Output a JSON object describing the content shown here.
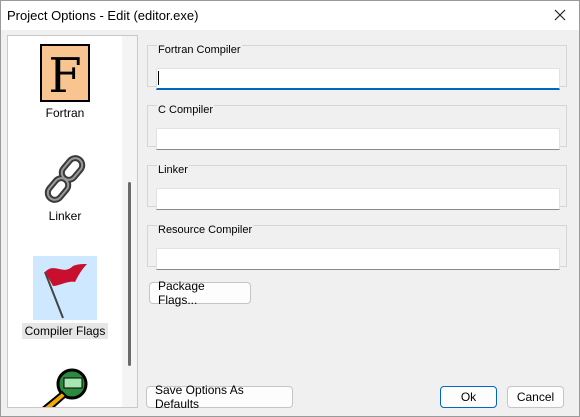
{
  "window": {
    "title": "Project Options - Edit (editor.exe)"
  },
  "sidebar": {
    "items": [
      {
        "label": "Fortran",
        "icon": "fortran-icon"
      },
      {
        "label": "Linker",
        "icon": "chain-link-icon"
      },
      {
        "label": "Compiler Flags",
        "icon": "red-flag-icon",
        "selected": true
      },
      {
        "label": "",
        "icon": "package-magnifier-icon"
      }
    ]
  },
  "groups": {
    "fortran": {
      "label": "Fortran Compiler",
      "value": ""
    },
    "c": {
      "label": "C Compiler",
      "value": ""
    },
    "linker": {
      "label": "Linker",
      "value": ""
    },
    "resource": {
      "label": "Resource Compiler",
      "value": ""
    }
  },
  "buttons": {
    "package_flags": "Package Flags...",
    "save_defaults": "Save Options As Defaults",
    "ok": "Ok",
    "cancel": "Cancel"
  },
  "colors": {
    "accent": "#0067c0",
    "flag": "#c8102e",
    "selection": "#cde8ff"
  }
}
